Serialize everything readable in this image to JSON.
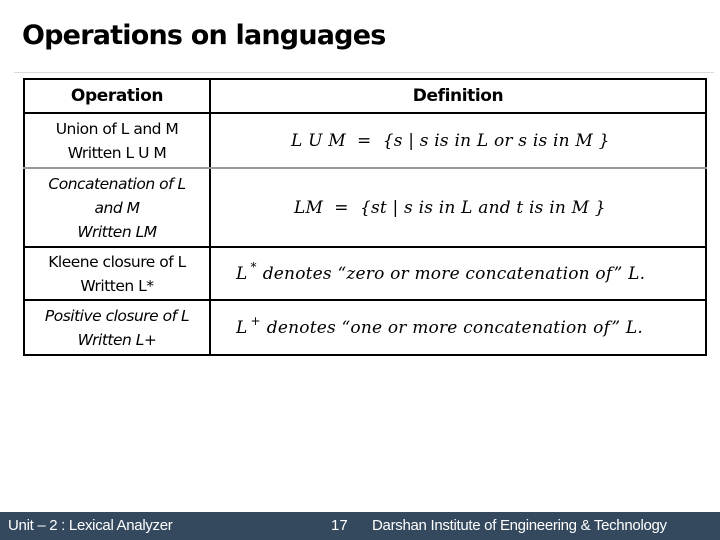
{
  "slide": {
    "title": "Operations on languages"
  },
  "table": {
    "headers": [
      "Operation",
      "Definition"
    ],
    "rows": [
      {
        "operation_line1": "Union of L and M",
        "operation_line2": "Written L U M",
        "operation_italic": false,
        "definition": "L U M  =  {s | s is in L or s is in M }"
      },
      {
        "operation_line1": "Concatenation of L",
        "operation_line2": "and M",
        "operation_line3": "Written LM",
        "operation_italic": true,
        "definition": "LM  =  {st | s is in L and t is in M }"
      },
      {
        "operation_line1": "Kleene closure of L",
        "operation_line2": "Written L*",
        "operation_italic": false,
        "definition_base": "L",
        "definition_sup": "*",
        "definition_rest": "denotes “zero or more concatenation of” L."
      },
      {
        "operation_line1": "Positive closure of L",
        "operation_line2": "Written L+",
        "operation_italic": true,
        "definition_base": "L",
        "definition_sup": "+",
        "definition_rest": "denotes “one or more concatenation of” L."
      }
    ]
  },
  "footer": {
    "unit": "Unit – 2 : Lexical Analyzer",
    "page_number": "17",
    "institute": "Darshan Institute of Engineering & Technology",
    "background_color": "#34495e"
  }
}
